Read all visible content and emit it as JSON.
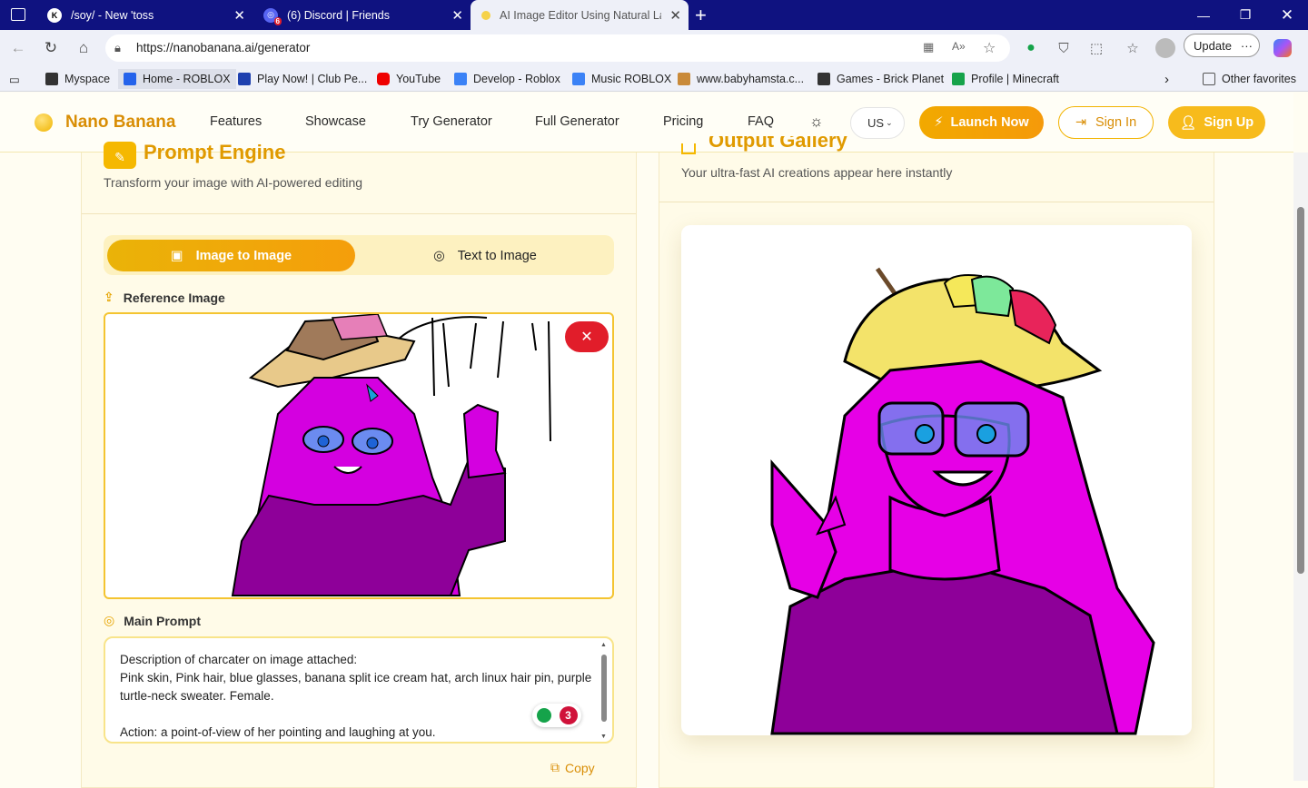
{
  "browser": {
    "tabs": [
      {
        "title": "/soy/ - New 'toss",
        "icon": "k-logo-icon"
      },
      {
        "title": "(6) Discord | Friends",
        "icon": "discord-icon",
        "badge": "6"
      },
      {
        "title": "AI Image Editor Using Natural Lan",
        "icon": "banana-icon"
      }
    ],
    "url": "https://nanobanana.ai/generator",
    "update_label": "Update",
    "bookmarks": [
      "Myspace",
      "Home - ROBLOX",
      "Play Now! | Club Pe...",
      "YouTube",
      "Develop - Roblox",
      "Music ROBLOX",
      "www.babyhamsta.c...",
      "Games - Brick Planet",
      "Profile | Minecraft"
    ],
    "other_favorites": "Other favorites"
  },
  "site": {
    "brand": "Nano Banana",
    "nav": [
      "Features",
      "Showcase",
      "Try Generator",
      "Full Generator",
      "Pricing",
      "FAQ"
    ],
    "lang": "US",
    "launch": "Launch Now",
    "signin": "Sign In",
    "signup": "Sign Up"
  },
  "left": {
    "title": "Prompt Engine",
    "subtitle": "Transform your image with AI-powered editing",
    "mode_image": "Image to Image",
    "mode_text": "Text to Image",
    "ref_label": "Reference Image",
    "prompt_label": "Main Prompt",
    "prompt_text": "Description of charcater on image attached:\nPink skin, Pink hair, blue glasses, banana split ice cream hat, arch linux hair pin, purple turtle-neck sweater. Female.\n\nAction: a point-of-view of her pointing and laughing at you.",
    "grammarly_count": "3",
    "copy": "Copy"
  },
  "right": {
    "title": "Output Gallery",
    "subtitle": "Your ultra-fast AI creations appear here instantly"
  },
  "colors": {
    "accent": "#f2a900",
    "brand": "#d98e06",
    "danger": "#e11d2a",
    "character": "#e600e6"
  }
}
